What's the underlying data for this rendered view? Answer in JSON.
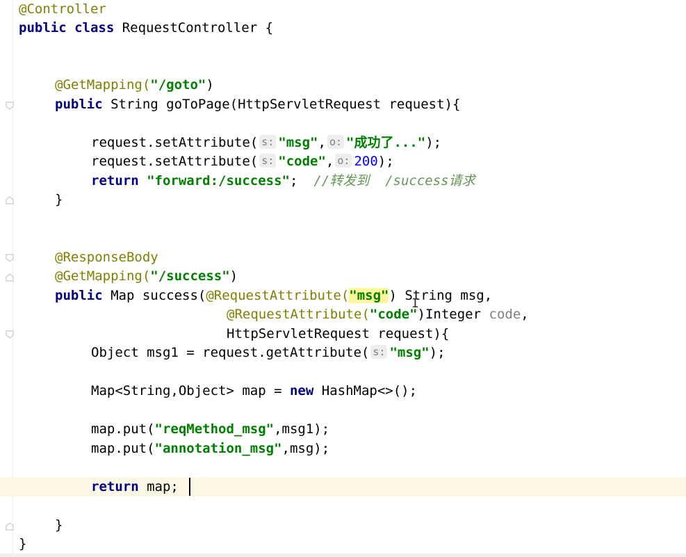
{
  "code": {
    "l1_ann": "@Controller",
    "l2_kw": "public class",
    "l2_rest": " RequestController {",
    "l3_ann": "@GetMapping(",
    "l3_str": "\"/goto\"",
    "l3_close": ")",
    "l4_kw": "public",
    "l4_rest": " String goToPage(HttpServletRequest request){",
    "l5_pre": "request.setAttribute(",
    "l5_hint1": "s:",
    "l5_str1": "\"msg\"",
    "l5_comma": ",",
    "l5_hint2": "o:",
    "l5_str2": "\"成功了...\"",
    "l5_end": ");",
    "l6_pre": "request.setAttribute(",
    "l6_hint1": "s:",
    "l6_str1": "\"code\"",
    "l6_comma": ",",
    "l6_hint2": "o:",
    "l6_num": "200",
    "l6_end": ");",
    "l7_kw": "return",
    "l7_str": "\"forward:/success\"",
    "l7_semi": ";",
    "l7_cmt": "//转发到  /success请求",
    "l8": "}",
    "l9_ann": "@ResponseBody",
    "l10_ann": "@GetMapping(",
    "l10_str": "\"/success\"",
    "l10_close": ")",
    "l11_kw": "public",
    "l11_mid": " Map success(",
    "l11_ann": "@RequestAttribute(",
    "l11_str": "\"msg\"",
    "l11_end": ") String msg,",
    "l12_ann": "@RequestAttribute(",
    "l12_str": "\"code\"",
    "l12_mid": ")Integer ",
    "l12_gray": "code",
    "l12_end": ",",
    "l13": "HttpServletRequest request){",
    "l14_pre": "Object msg1 = request.getAttribute(",
    "l14_hint": "s:",
    "l14_str": "\"msg\"",
    "l14_end": ");",
    "l15_pre": "Map<String,Object> map = ",
    "l15_kw": "new",
    "l15_end": " HashMap<>();",
    "l16_pre": "map.put(",
    "l16_str": "\"reqMethod_msg\"",
    "l16_end": ",msg1);",
    "l17_pre": "map.put(",
    "l17_str": "\"annotation_msg\"",
    "l17_end": ",msg);",
    "l18_kw": "return",
    "l18_end": " map;",
    "l19": "}",
    "l20": "}"
  },
  "colors": {
    "keyword": "#000080",
    "annotation": "#808000",
    "string": "#008000",
    "number": "#0000ff",
    "comment": "#629755",
    "current_line": "#fcf7e4"
  }
}
